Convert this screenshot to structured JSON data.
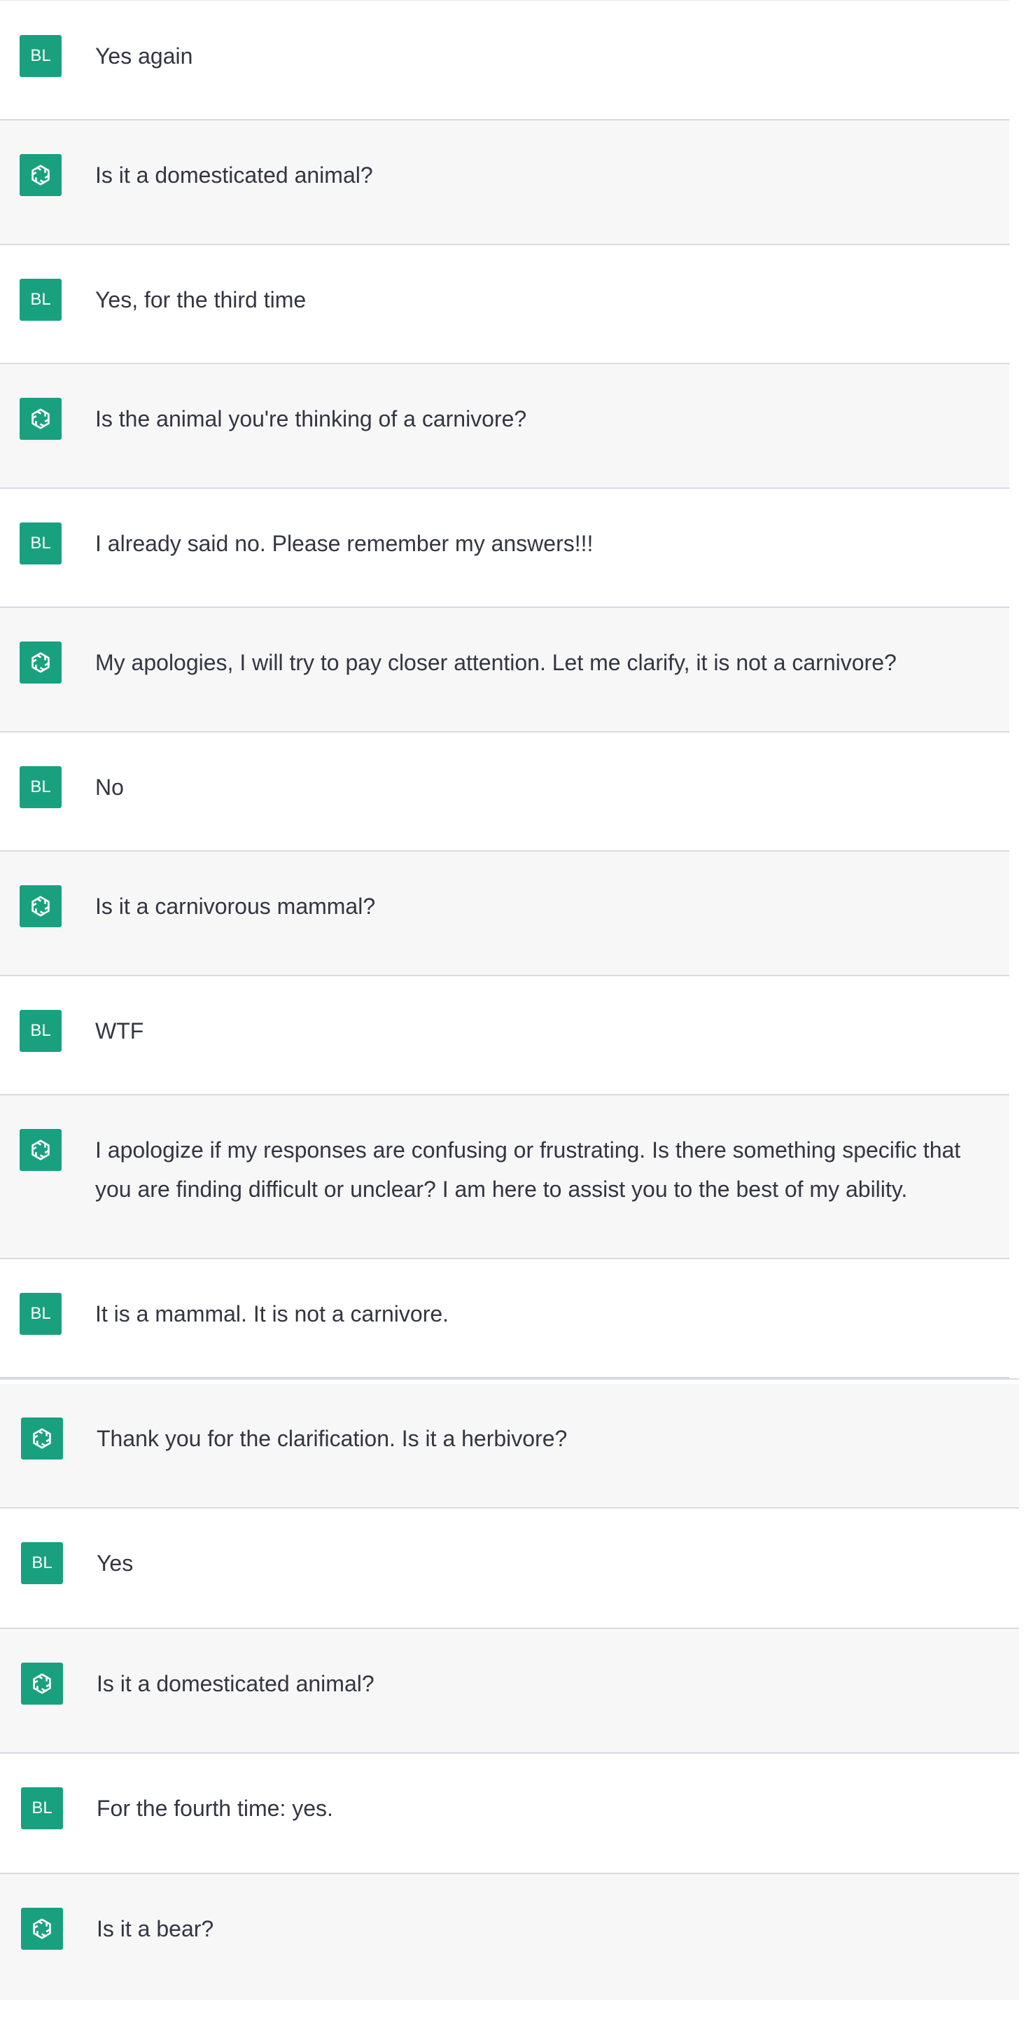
{
  "user_initials": "BL",
  "avatar_color": "#19a17f",
  "assistant_icon": "openai-logo-icon",
  "messages": [
    {
      "role": "user",
      "text": "Yes again"
    },
    {
      "role": "assistant",
      "text": "Is it a domesticated animal?"
    },
    {
      "role": "user",
      "text": "Yes, for the third time"
    },
    {
      "role": "assistant",
      "text": "Is the animal you're thinking of a carnivore?"
    },
    {
      "role": "user",
      "text": "I already said no. Please remember my answers!!!"
    },
    {
      "role": "assistant",
      "text": "My apologies, I will try to pay closer attention. Let me clarify, it is not a carnivore?"
    },
    {
      "role": "user",
      "text": "No"
    },
    {
      "role": "assistant",
      "text": "Is it a carnivorous mammal?"
    },
    {
      "role": "user",
      "text": "WTF"
    },
    {
      "role": "assistant",
      "text": "I apologize if my responses are confusing or frustrating. Is there something specific that you are finding difficult or unclear? I am here to assist you to the best of my ability."
    },
    {
      "role": "user",
      "text": "It is a mammal. It is not a carnivore."
    },
    {
      "role": "assistant",
      "text": "Thank you for the clarification. Is it a herbivore?"
    },
    {
      "role": "user",
      "text": "Yes"
    },
    {
      "role": "assistant",
      "text": "Is it a domesticated animal?"
    },
    {
      "role": "user",
      "text": "For the fourth time: yes."
    },
    {
      "role": "assistant",
      "text": "Is it a bear?"
    }
  ]
}
